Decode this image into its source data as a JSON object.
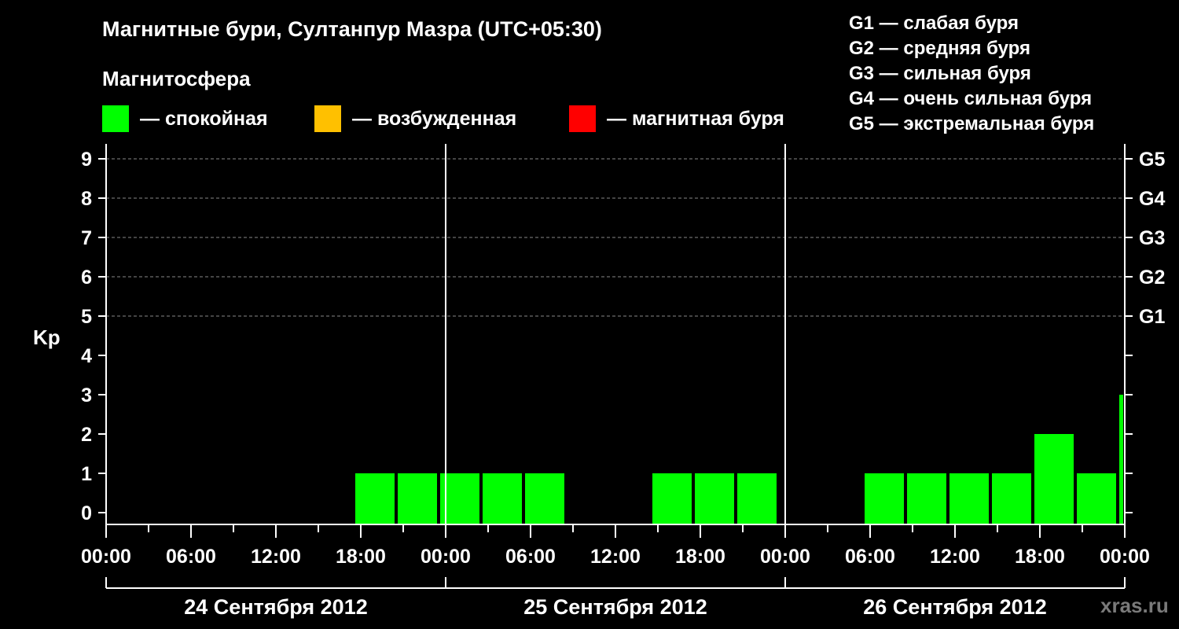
{
  "header": {
    "title": "Магнитные бури, Султанпур Мазра (UTC+05:30)",
    "subtitle": "Магнитосфера"
  },
  "legend": [
    {
      "label": "— спокойная",
      "color": "#00ff00"
    },
    {
      "label": "— возбужденная",
      "color": "#ffc000"
    },
    {
      "label": "— магнитная буря",
      "color": "#ff0000"
    }
  ],
  "storm_levels": [
    "G1 — слабая буря",
    "G2 — средняя буря",
    "G3 — сильная буря",
    "G4 — очень сильная буря",
    "G5 — экстремальная буря"
  ],
  "credit": "xras.ru",
  "chart_data": {
    "type": "bar",
    "ylabel": "Kp",
    "ylim": [
      0,
      9
    ],
    "yticks": [
      0,
      1,
      2,
      3,
      4,
      5,
      6,
      7,
      8,
      9
    ],
    "right_axis": [
      {
        "kp": 5,
        "label": "G1"
      },
      {
        "kp": 6,
        "label": "G2"
      },
      {
        "kp": 7,
        "label": "G3"
      },
      {
        "kp": 8,
        "label": "G4"
      },
      {
        "kp": 9,
        "label": "G5"
      }
    ],
    "x_tick_labels": [
      "00:00",
      "06:00",
      "12:00",
      "18:00",
      "00:00",
      "06:00",
      "12:00",
      "18:00",
      "00:00",
      "06:00",
      "12:00",
      "18:00",
      "00:00"
    ],
    "days": [
      "24 Сентября 2012",
      "25 Сентября 2012",
      "26 Сентября 2012"
    ],
    "grid": true,
    "bar_color": "#00ff00",
    "bars": [
      {
        "start": "2012-09-24 17:30",
        "kp": 1
      },
      {
        "start": "2012-09-24 20:30",
        "kp": 1
      },
      {
        "start": "2012-09-24 23:30",
        "kp": 1
      },
      {
        "start": "2012-09-25 02:30",
        "kp": 1
      },
      {
        "start": "2012-09-25 05:30",
        "kp": 1
      },
      {
        "start": "2012-09-25 14:30",
        "kp": 1
      },
      {
        "start": "2012-09-25 17:30",
        "kp": 1
      },
      {
        "start": "2012-09-25 20:30",
        "kp": 1
      },
      {
        "start": "2012-09-26 05:30",
        "kp": 1
      },
      {
        "start": "2012-09-26 08:30",
        "kp": 1
      },
      {
        "start": "2012-09-26 11:30",
        "kp": 1
      },
      {
        "start": "2012-09-26 14:30",
        "kp": 1
      },
      {
        "start": "2012-09-26 17:30",
        "kp": 2
      },
      {
        "start": "2012-09-26 20:30",
        "kp": 1
      },
      {
        "start": "2012-09-26 23:30",
        "kp": 3
      }
    ]
  }
}
